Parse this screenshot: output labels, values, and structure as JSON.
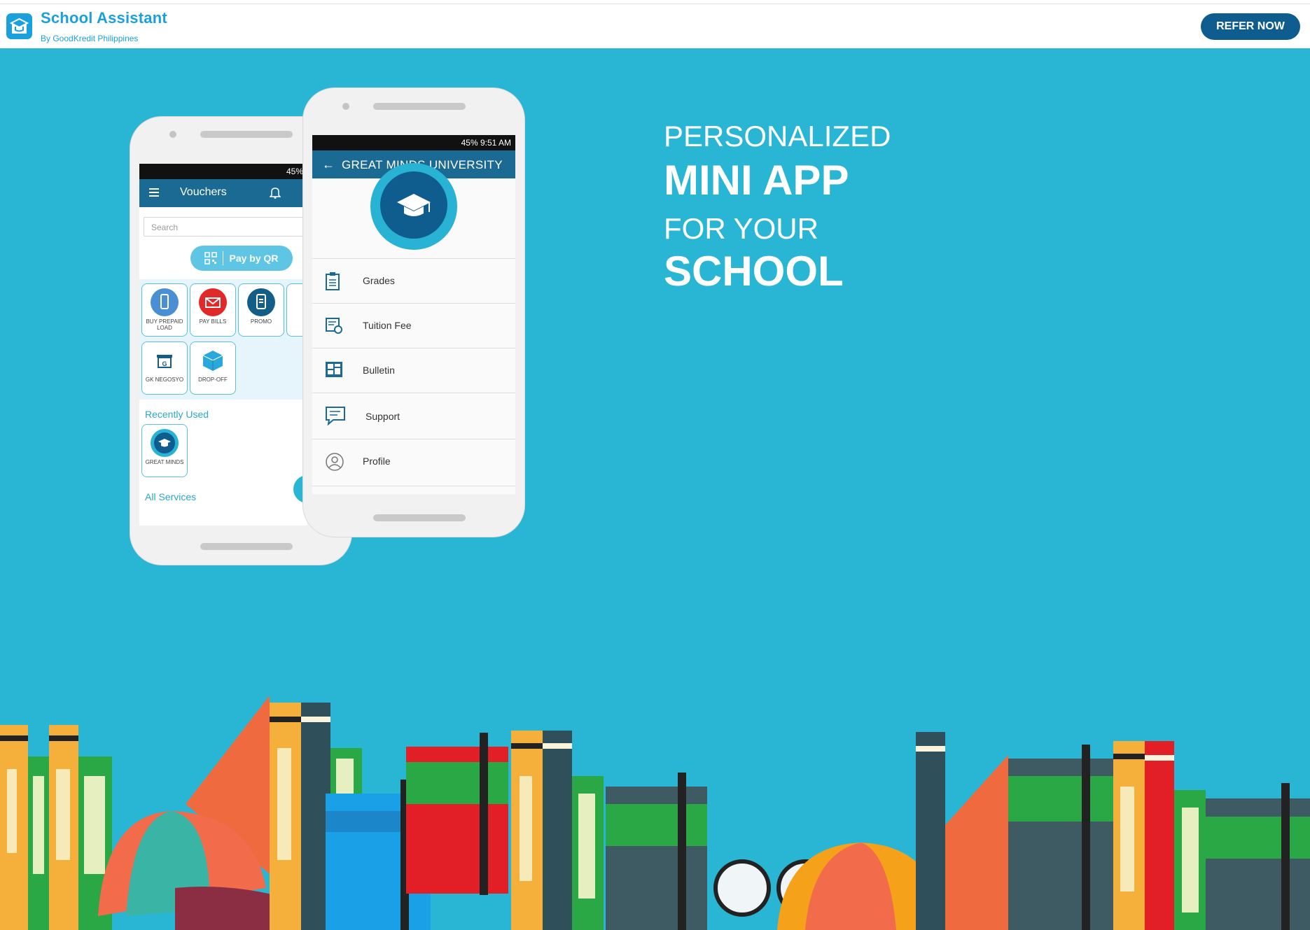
{
  "header": {
    "brand_title": "School Assistant",
    "brand_subtitle": "By GoodKredit Philippines",
    "cta_label": "REFER NOW",
    "logo_icon": "graduation-cap-icon"
  },
  "hero": {
    "line1": "PERSONALIZED",
    "line2": "MINI APP",
    "line3": "FOR YOUR",
    "line4": "SCHOOL",
    "background_color": "#29b6d4"
  },
  "phone_back": {
    "status": "45%",
    "title": "Vouchers",
    "search_placeholder": "Search",
    "pay_by_qr": "Pay by QR",
    "tiles": [
      {
        "label": "BUY PREPAID LOAD",
        "icon": "mobile-phone-icon",
        "color": "#4a8fd4"
      },
      {
        "label": "PAY BILLS",
        "icon": "envelope-icon",
        "color": "#e02a2a"
      },
      {
        "label": "PROMO",
        "icon": "promo-phone-icon",
        "color": "#135d86"
      },
      {
        "label": "GK NEGOSYO",
        "icon": "store-icon",
        "color": "#ffffff"
      },
      {
        "label": "DROP-OFF",
        "icon": "box-icon",
        "color": "#ffffff"
      }
    ],
    "recently_used_label": "Recently Used",
    "recent_tile": {
      "label": "GREAT MINDS",
      "icon": "graduation-cap-icon"
    },
    "all_services_label": "All Services"
  },
  "phone_front": {
    "status": "45% 9:51 AM",
    "title": "GREAT MINDS UNIVERSITY",
    "menu": [
      {
        "label": "Grades",
        "icon": "clipboard-icon"
      },
      {
        "label": "Tuition Fee",
        "icon": "receipt-icon"
      },
      {
        "label": "Bulletin",
        "icon": "bulletin-board-icon"
      },
      {
        "label": "Support",
        "icon": "chat-bubble-icon"
      },
      {
        "label": "Profile",
        "icon": "user-circle-icon"
      }
    ]
  }
}
